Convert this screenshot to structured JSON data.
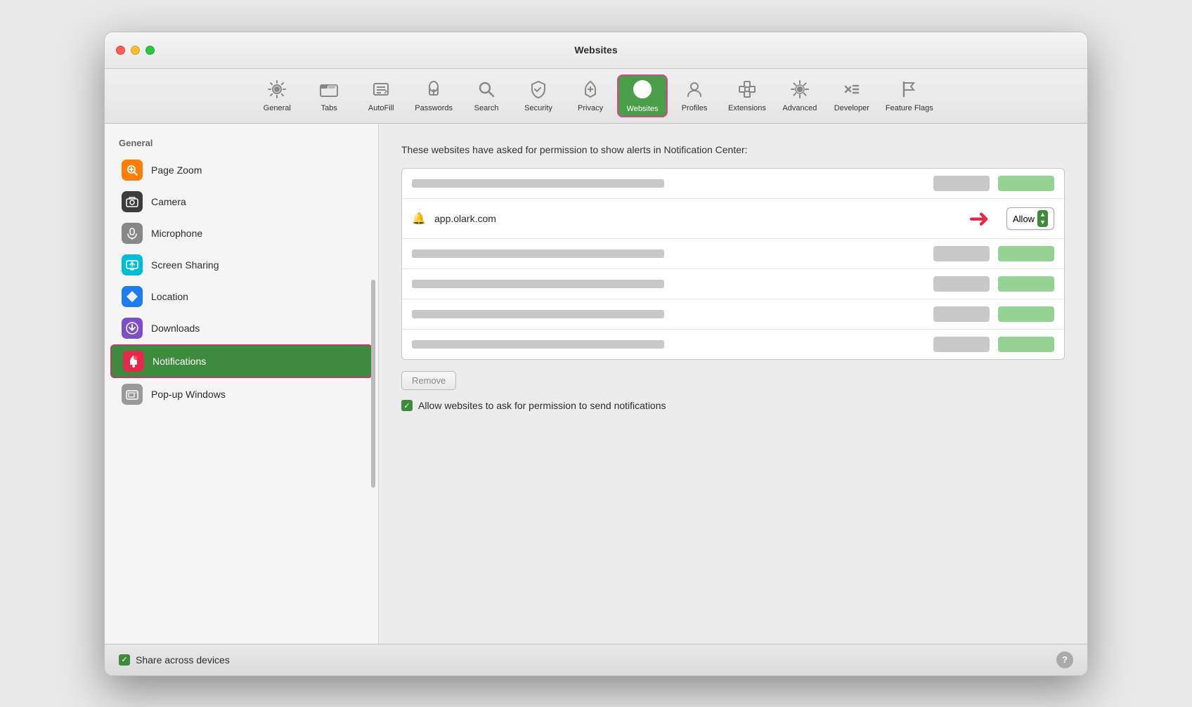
{
  "window": {
    "title": "Websites"
  },
  "toolbar": {
    "items": [
      {
        "id": "general",
        "label": "General",
        "icon": "⚙️"
      },
      {
        "id": "tabs",
        "label": "Tabs",
        "icon": "📑"
      },
      {
        "id": "autofill",
        "label": "AutoFill",
        "icon": "✏️"
      },
      {
        "id": "passwords",
        "label": "Passwords",
        "icon": "🔑"
      },
      {
        "id": "search",
        "label": "Search",
        "icon": "🔍"
      },
      {
        "id": "security",
        "label": "Security",
        "icon": "🔒"
      },
      {
        "id": "privacy",
        "label": "Privacy",
        "icon": "✋"
      },
      {
        "id": "websites",
        "label": "Websites",
        "icon": "🌐",
        "active": true
      },
      {
        "id": "profiles",
        "label": "Profiles",
        "icon": "👤"
      },
      {
        "id": "extensions",
        "label": "Extensions",
        "icon": "🧩"
      },
      {
        "id": "advanced",
        "label": "Advanced",
        "icon": "⚙️"
      },
      {
        "id": "developer",
        "label": "Developer",
        "icon": "🔧"
      },
      {
        "id": "featureflags",
        "label": "Feature Flags",
        "icon": "🚩"
      }
    ]
  },
  "sidebar": {
    "section_title": "General",
    "items": [
      {
        "id": "page-zoom",
        "label": "Page Zoom",
        "icon": "🔍",
        "color": "orange"
      },
      {
        "id": "camera",
        "label": "Camera",
        "icon": "📷",
        "color": "dark"
      },
      {
        "id": "microphone",
        "label": "Microphone",
        "icon": "🎤",
        "color": "gray"
      },
      {
        "id": "screen-sharing",
        "label": "Screen Sharing",
        "icon": "📺",
        "color": "teal"
      },
      {
        "id": "location",
        "label": "Location",
        "icon": "➤",
        "color": "blue"
      },
      {
        "id": "downloads",
        "label": "Downloads",
        "icon": "⬇",
        "color": "purple"
      },
      {
        "id": "notifications",
        "label": "Notifications",
        "icon": "🔔",
        "color": "red-notif",
        "selected": true
      },
      {
        "id": "popup-windows",
        "label": "Pop-up Windows",
        "icon": "🪟",
        "color": "lgray"
      }
    ]
  },
  "main": {
    "description": "These websites have asked for permission to show alerts in Notification Center:",
    "featured_site": {
      "icon": "🔔",
      "name": "app.olark.com"
    },
    "allow_label": "Allow",
    "remove_button": "Remove",
    "checkbox": {
      "checked": true,
      "label": "Allow websites to ask for permission to send notifications"
    }
  },
  "footer": {
    "checkbox_label": "Share across devices",
    "checkbox_checked": true,
    "help_label": "?"
  }
}
